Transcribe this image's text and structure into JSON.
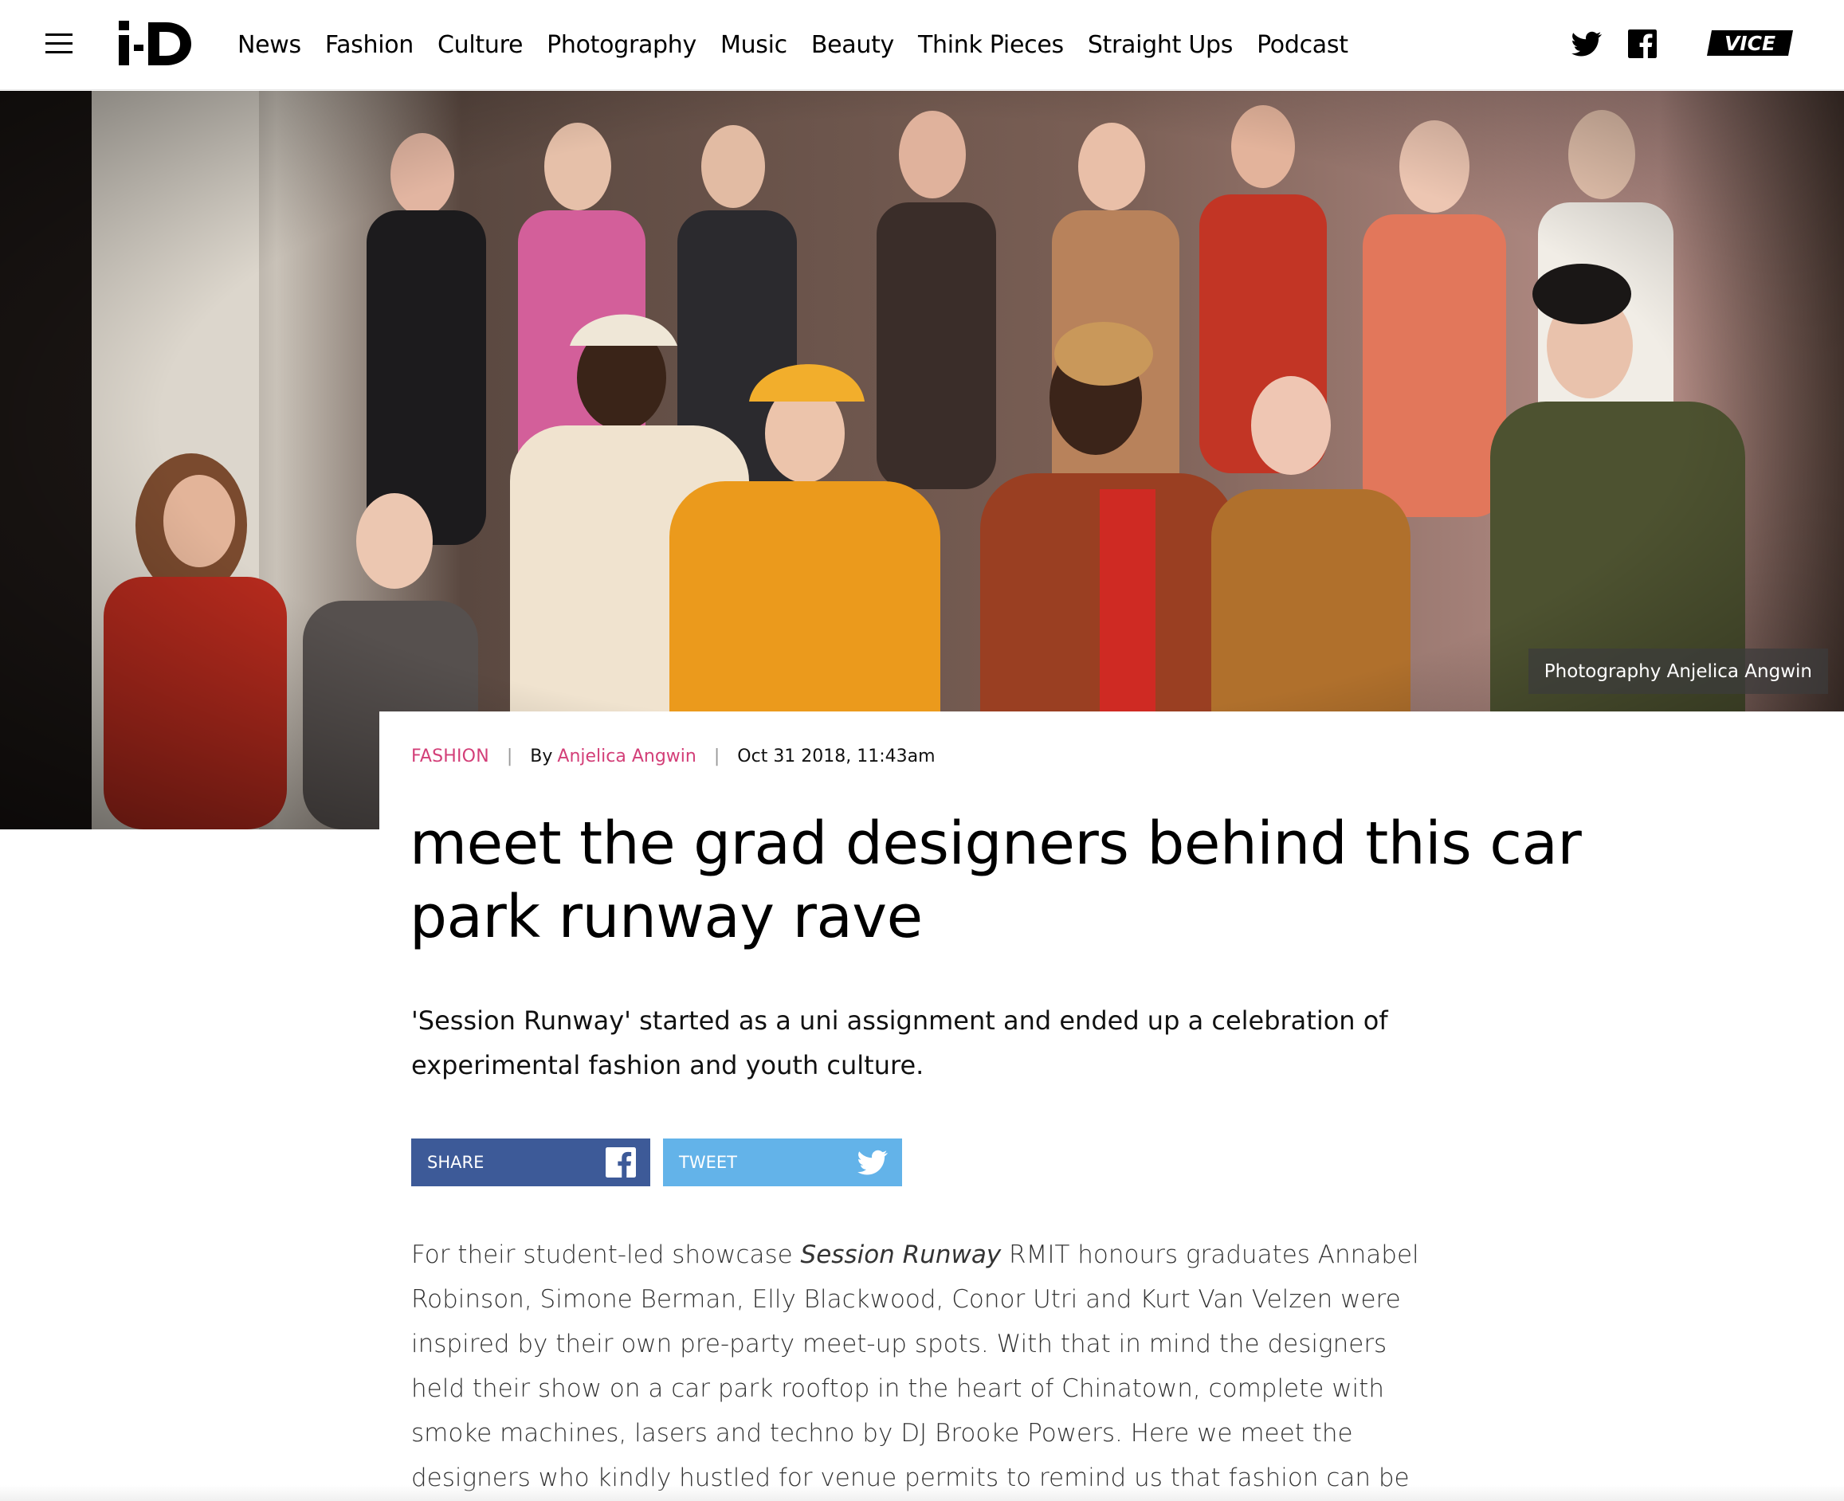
{
  "header": {
    "menu_icon": "hamburger-icon",
    "logo_text": "i-D",
    "nav": [
      "News",
      "Fashion",
      "Culture",
      "Photography",
      "Music",
      "Beauty",
      "Think Pieces",
      "Straight Ups",
      "Podcast"
    ],
    "social": [
      "twitter-icon",
      "facebook-icon"
    ],
    "partner_logo_text": "VICE"
  },
  "hero": {
    "credit": "Photography Anjelica Angwin"
  },
  "article": {
    "category": "FASHION",
    "by": "By",
    "author": "Anjelica Angwin",
    "date": "Oct 31 2018, 11:43am",
    "headline": "meet the grad designers behind this car park runway rave",
    "standfirst": "'Session Runway' started as a uni assignment and ended up a celebration of experimental fashion and youth culture.",
    "share_label": "SHARE",
    "tweet_label": "TWEET",
    "body_prefix": "For their student-led showcase ",
    "body_italic": "Session Runway",
    "body_suffix": " RMIT honours graduates Annabel Robinson, Simone Berman, Elly Blackwood, Conor Utri and Kurt Van Velzen were inspired by their own pre-party meet-up spots. With that in mind the designers held their show on a car park rooftop in the heart of Chinatown, complete with smoke machines, lasers and techno by DJ Brooke Powers. Here we meet the designers who kindly hustled for venue permits to remind us that fashion can be fun and a little bit dangerous."
  },
  "colors": {
    "accent_pink": "#d33f78",
    "facebook_blue": "#3d5a98",
    "twitter_blue": "#63b3e9"
  }
}
